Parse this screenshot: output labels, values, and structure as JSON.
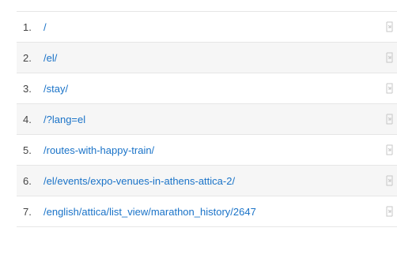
{
  "rows": [
    {
      "rank": "1.",
      "path": "/",
      "icon": "open-link-icon"
    },
    {
      "rank": "2.",
      "path": "/el/",
      "icon": "open-link-icon"
    },
    {
      "rank": "3.",
      "path": "/stay/",
      "icon": "open-link-icon"
    },
    {
      "rank": "4.",
      "path": "/?lang=el",
      "icon": "open-link-icon"
    },
    {
      "rank": "5.",
      "path": "/routes-with-happy-train/",
      "icon": "open-link-icon"
    },
    {
      "rank": "6.",
      "path": "/el/events/expo-venues-in-athens-attica-2/",
      "icon": "open-link-icon"
    },
    {
      "rank": "7.",
      "path": "/english/attica/list_view/marathon_history/2647",
      "icon": "open-link-icon"
    }
  ],
  "colors": {
    "link": "#1a73c8",
    "rank_text": "#444444",
    "row_alt_bg": "#f6f6f6",
    "divider": "#e6e6e6",
    "icon": "#c7c7c7"
  }
}
